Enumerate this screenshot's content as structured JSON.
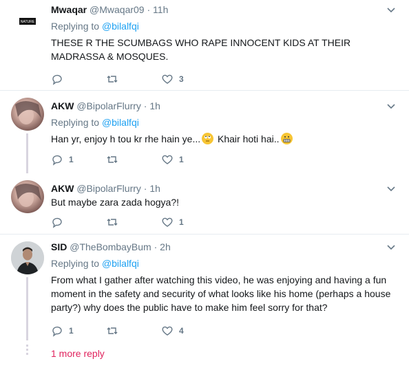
{
  "tweets": [
    {
      "name": "Mwaqar",
      "handle": "@Mwaqar09",
      "dot": "·",
      "time": "11h",
      "replying_prefix": "Replying to ",
      "replying_to": "@bilalfqi",
      "text": "THESE R THE SCUMBAGS WHO RAPE INNOCENT KIDS AT THEIR MADRASSA & MOSQUES.",
      "replies": "",
      "retweets": "",
      "likes": "3",
      "avatar_icon": "logo-avatar"
    },
    {
      "name": "AKW",
      "handle": "@BipolarFlurry",
      "dot": "·",
      "time": "1h",
      "replying_prefix": "Replying to ",
      "replying_to": "@bilalfqi",
      "text_a": "Han yr, enjoy h tou kr rhe hain ye...",
      "text_b": " Khair hoti hai..",
      "replies": "1",
      "retweets": "",
      "likes": "1",
      "avatar_icon": "user-photo-avatar"
    },
    {
      "name": "AKW",
      "handle": "@BipolarFlurry",
      "dot": "·",
      "time": "1h",
      "text": "But maybe zara zada hogya?!",
      "replies": "",
      "retweets": "",
      "likes": "1",
      "avatar_icon": "user-photo-avatar"
    },
    {
      "name": "SID",
      "handle": "@TheBombayBum",
      "dot": "·",
      "time": "2h",
      "replying_prefix": "Replying to ",
      "replying_to": "@bilalfqi",
      "text": "From what I gather after watching this video, he was enjoying and having a fun moment in the safety and security of what looks like his home (perhaps a house party?) why does the public have to make him feel sorry for that?",
      "replies": "1",
      "retweets": "",
      "likes": "4",
      "avatar_icon": "user-photo-avatar"
    }
  ],
  "more_replies": "1 more reply",
  "icons": {
    "reply": "reply-icon",
    "retweet": "retweet-icon",
    "like": "heart-icon",
    "menu": "chevron-down-icon",
    "emoji1": "face-with-rolling-eyes-emoji",
    "emoji2": "grimacing-face-emoji"
  },
  "colors": {
    "link": "#1da1f2",
    "muted": "#657786",
    "more_reply": "#e0245e",
    "thread": "#d8d4df"
  }
}
